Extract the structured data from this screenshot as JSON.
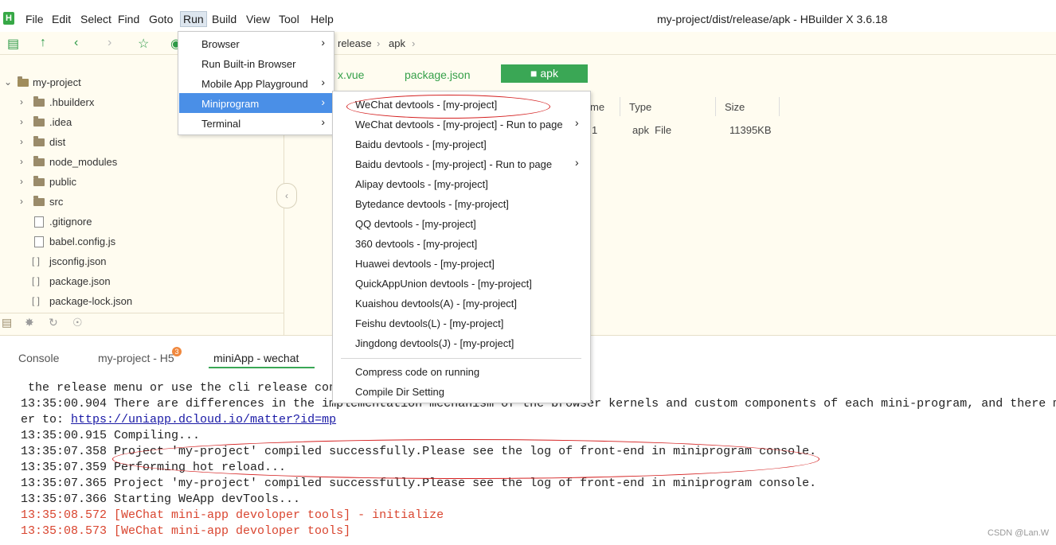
{
  "app": {
    "logo_letter": "H",
    "window_title": "my-project/dist/release/apk - HBuilder X 3.6.18"
  },
  "menubar": [
    "File",
    "Edit",
    "Select",
    "Find",
    "Goto",
    "Run",
    "Build",
    "View",
    "Tool",
    "Help"
  ],
  "breadcrumb": [
    "release",
    "apk"
  ],
  "sidebar": {
    "root": "my-project",
    "items": [
      {
        "label": ".hbuilderx",
        "kind": "folder"
      },
      {
        "label": ".idea",
        "kind": "folder"
      },
      {
        "label": "dist",
        "kind": "folder"
      },
      {
        "label": "node_modules",
        "kind": "folder"
      },
      {
        "label": "public",
        "kind": "folder"
      },
      {
        "label": "src",
        "kind": "folder"
      },
      {
        "label": ".gitignore",
        "kind": "file"
      },
      {
        "label": "babel.config.js",
        "kind": "file"
      },
      {
        "label": "jsconfig.json",
        "kind": "json"
      },
      {
        "label": "package.json",
        "kind": "json"
      },
      {
        "label": "package-lock.json",
        "kind": "json"
      }
    ]
  },
  "editor": {
    "tabs": [
      "x.vue",
      "package.json"
    ],
    "active_tab": "apk",
    "columns": [
      "me",
      "Type",
      "Size"
    ],
    "row": {
      "name": "1",
      "type": "apk  File",
      "size": "11395KB"
    }
  },
  "run_menu": [
    {
      "label": "Browser",
      "submenu": true
    },
    {
      "label": "Run Built-in Browser",
      "submenu": false
    },
    {
      "label": "Mobile App Playground",
      "submenu": true
    },
    {
      "label": "Miniprogram",
      "submenu": true,
      "highlighted": true
    },
    {
      "label": "Terminal",
      "submenu": true
    }
  ],
  "miniprogram_menu": [
    {
      "label": "WeChat devtools - [my-project]",
      "submenu": false
    },
    {
      "label": "WeChat devtools - [my-project] - Run to page",
      "submenu": true
    },
    {
      "label": "Baidu devtools - [my-project]",
      "submenu": false
    },
    {
      "label": "Baidu devtools - [my-project] - Run to page",
      "submenu": true
    },
    {
      "label": "Alipay devtools - [my-project]",
      "submenu": false
    },
    {
      "label": "Bytedance devtools - [my-project]",
      "submenu": false
    },
    {
      "label": "QQ devtools - [my-project]",
      "submenu": false
    },
    {
      "label": "360 devtools - [my-project]",
      "submenu": false
    },
    {
      "label": "Huawei devtools - [my-project]",
      "submenu": false
    },
    {
      "label": "QuickAppUnion devtools - [my-project]",
      "submenu": false
    },
    {
      "label": "Kuaishou devtools(A) - [my-project]",
      "submenu": false
    },
    {
      "label": "Feishu devtools(L) - [my-project]",
      "submenu": false
    },
    {
      "label": "Jingdong devtools(J) - [my-project]",
      "submenu": false
    },
    {
      "label": "Compress code on running",
      "submenu": false
    },
    {
      "label": "Compile Dir Setting",
      "submenu": false
    }
  ],
  "console": {
    "tabs": [
      "Console",
      "my-project - H5",
      "miniApp - wechat"
    ],
    "badge": "3",
    "lines": [
      {
        "text": " the release menu or use the cli release con",
        "color": "normal"
      },
      {
        "text": "13:35:00.904 There are differences in the implementation mechanism of the browser kernels and custom components of each mini-program, and there m",
        "color": "normal"
      },
      {
        "text": "er to: ",
        "link": "https://uniapp.dcloud.io/matter?id=mp",
        "color": "normal"
      },
      {
        "text": "13:35:00.915 Compiling...",
        "color": "normal"
      },
      {
        "text": "13:35:07.358 Project 'my-project' compiled successfully.Please see the log of front-end in miniprogram console.",
        "color": "normal"
      },
      {
        "text": "13:35:07.359 Performing hot reload...",
        "color": "normal"
      },
      {
        "text": "13:35:07.365 Project 'my-project' compiled successfully.Please see the log of front-end in miniprogram console.",
        "color": "normal"
      },
      {
        "text": "13:35:07.366 Starting WeApp devTools...",
        "color": "normal"
      },
      {
        "text": "13:35:08.572 [WeChat mini-app devoloper tools] - initialize",
        "color": "red"
      },
      {
        "text": "13:35:08.573 [WeChat mini-app devoloper tools]",
        "color": "red"
      }
    ]
  },
  "watermark": "CSDN @Lan.W",
  "colors": {
    "accent": "#3aa755",
    "highlight": "#4a8fe7",
    "annotation": "#d42020"
  }
}
